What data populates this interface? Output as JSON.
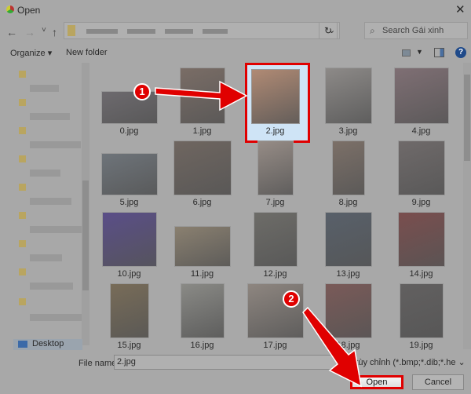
{
  "window": {
    "title": "Open",
    "close_icon": "close-icon"
  },
  "nav": {
    "back": "←",
    "forward": "→",
    "recent": "˅",
    "up": "↑",
    "refresh": "↻",
    "dropdown": "⌄"
  },
  "search": {
    "placeholder": "Search Gái xinh"
  },
  "toolbar": {
    "organize": "Organize ▾",
    "new_folder": "New folder"
  },
  "sidebar": {
    "selected": "Desktop"
  },
  "files": [
    "0.jpg",
    "1.jpg",
    "2.jpg",
    "3.jpg",
    "4.jpg",
    "5.jpg",
    "6.jpg",
    "7.jpg",
    "8.jpg",
    "9.jpg",
    "10.jpg",
    "11.jpg",
    "12.jpg",
    "13.jpg",
    "14.jpg",
    "15.jpg",
    "16.jpg",
    "17.jpg",
    "18.jpg",
    "19.jpg"
  ],
  "selected_file": "2.jpg",
  "footer": {
    "file_name_label": "File name:",
    "file_name_value": "2.jpg",
    "filter": "ệp tùy chỉnh (*.bmp;*.dib;*.he ⌄",
    "open": "Open",
    "cancel": "Cancel"
  },
  "annotations": {
    "step1": "1",
    "step2": "2",
    "color": "#e00000"
  }
}
